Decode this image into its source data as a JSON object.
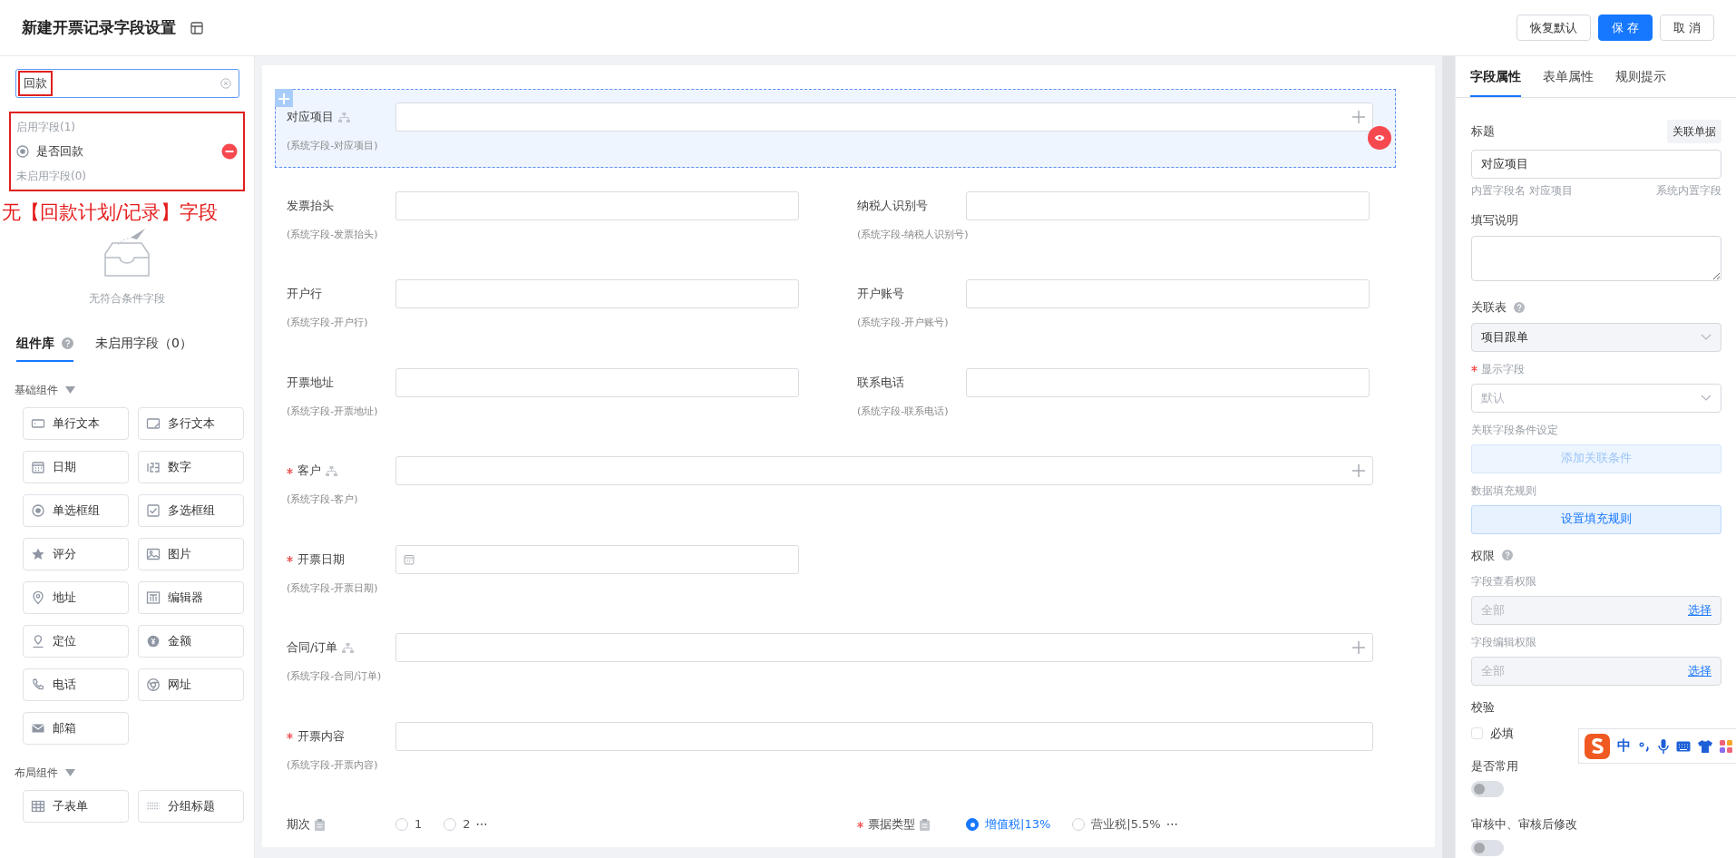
{
  "header": {
    "title": "新建开票记录字段设置",
    "buttons": [
      {
        "label": "恢复默认",
        "kind": "default"
      },
      {
        "label": "保 存",
        "kind": "primary"
      },
      {
        "label": "取 消",
        "kind": "default"
      }
    ]
  },
  "left_panel": {
    "search": {
      "value": "回款"
    },
    "results": {
      "enabled_heading": "启用字段(1)",
      "enabled": [
        {
          "label": "是否回款",
          "selected": true
        }
      ],
      "disabled_heading": "未启用字段(0)"
    },
    "annotation": "无【回款计划/记录】字段",
    "empty_text": "无符合条件字段",
    "tabs": [
      {
        "label": "组件库",
        "selected": true,
        "help": true
      },
      {
        "label": "未启用字段（0）",
        "selected": false,
        "help": false
      }
    ],
    "groups": [
      {
        "title": "基础组件",
        "items": [
          {
            "label": "单行文本"
          },
          {
            "label": "多行文本"
          },
          {
            "label": "日期"
          },
          {
            "label": "数字"
          },
          {
            "label": "单选框组"
          },
          {
            "label": "多选框组"
          },
          {
            "label": "评分"
          },
          {
            "label": "图片"
          },
          {
            "label": "地址"
          },
          {
            "label": "编辑器"
          },
          {
            "label": "定位"
          },
          {
            "label": "金额"
          },
          {
            "label": "电话"
          },
          {
            "label": "网址"
          },
          {
            "label": "邮箱"
          }
        ]
      },
      {
        "title": "布局组件",
        "items": [
          {
            "label": "子表单"
          },
          {
            "label": "分组标题"
          }
        ]
      }
    ]
  },
  "form": {
    "rows": [
      {
        "fields": [
          {
            "label": "对应项目",
            "kind": "lookup",
            "required": false,
            "linked": true,
            "selected": true,
            "hint": "(系统字段-对应项目)"
          }
        ]
      },
      {
        "fields": [
          {
            "label": "发票抬头",
            "kind": "text",
            "required": false,
            "linked": false,
            "selected": false,
            "hint": "(系统字段-发票抬头)"
          },
          {
            "label": "纳税人识别号",
            "kind": "text",
            "required": false,
            "linked": false,
            "selected": false,
            "hint": "(系统字段-纳税人识别号)"
          }
        ]
      },
      {
        "fields": [
          {
            "label": "开户行",
            "kind": "text",
            "required": false,
            "linked": false,
            "selected": false,
            "hint": "(系统字段-开户行)"
          },
          {
            "label": "开户账号",
            "kind": "text",
            "required": false,
            "linked": false,
            "selected": false,
            "hint": "(系统字段-开户账号)"
          }
        ]
      },
      {
        "fields": [
          {
            "label": "开票地址",
            "kind": "text",
            "required": false,
            "linked": false,
            "selected": false,
            "hint": "(系统字段-开票地址)"
          },
          {
            "label": "联系电话",
            "kind": "text",
            "required": false,
            "linked": false,
            "selected": false,
            "hint": "(系统字段-联系电话)"
          }
        ]
      },
      {
        "fields": [
          {
            "label": "客户",
            "kind": "lookup",
            "required": true,
            "linked": true,
            "selected": false,
            "hint": "(系统字段-客户)"
          }
        ]
      },
      {
        "fields": [
          {
            "label": "开票日期",
            "kind": "date",
            "required": true,
            "linked": false,
            "selected": false,
            "hint": "(系统字段-开票日期)"
          }
        ]
      },
      {
        "fields": [
          {
            "label": "合同/订单",
            "kind": "lookup",
            "required": false,
            "linked": true,
            "selected": false,
            "hint": "(系统字段-合同/订单)"
          }
        ]
      },
      {
        "fields": [
          {
            "label": "开票内容",
            "kind": "text",
            "required": true,
            "linked": false,
            "selected": false,
            "hint": "(系统字段-开票内容)"
          }
        ]
      },
      {
        "fields": [
          {
            "label": "期次",
            "kind": "radio",
            "required": false,
            "linked": false,
            "selected": false,
            "options": [
              {
                "label": "1",
                "selected": false
              },
              {
                "label": "2",
                "selected": false
              }
            ],
            "more": "⋯"
          },
          {
            "label": "票据类型",
            "kind": "radio",
            "required": true,
            "linked": false,
            "selected": false,
            "options": [
              {
                "label": "增值税|13%",
                "selected": true
              },
              {
                "label": "营业税|5.5%",
                "selected": false
              }
            ],
            "more": "⋯"
          }
        ]
      }
    ]
  },
  "right_panel": {
    "tabs": [
      {
        "label": "字段属性",
        "selected": true
      },
      {
        "label": "表单属性",
        "selected": false
      },
      {
        "label": "规则提示",
        "selected": false
      }
    ],
    "title_label": "标题",
    "link_button": "关联单据",
    "title_value": "对应项目",
    "builtin_name": "内置字段名 对应项目",
    "builtin_tag": "系统内置字段",
    "description_label": "填写说明",
    "link_table_label": "关联表",
    "link_table_value": "项目跟单",
    "display_field_label": "显示字段",
    "display_field_required": true,
    "display_field_placeholder": "默认",
    "condition_label": "关联字段条件设定",
    "condition_button": {
      "label": "添加关联条件",
      "disabled": true
    },
    "fill_label": "数据填充规则",
    "fill_button": {
      "label": "设置填充规则",
      "disabled": false
    },
    "permission_label": "权限",
    "permissions": [
      {
        "label": "字段查看权限",
        "value": "全部",
        "action": "选择"
      },
      {
        "label": "字段编辑权限",
        "value": "全部",
        "action": "选择"
      }
    ],
    "validation_label": "校验",
    "required_check": {
      "label": "必填",
      "checked": false
    },
    "switches": [
      {
        "label": "是否常用",
        "on": false
      },
      {
        "label": "审核中、审核后修改",
        "on": false
      }
    ]
  },
  "ime_toolbar": {
    "mode": "中"
  }
}
